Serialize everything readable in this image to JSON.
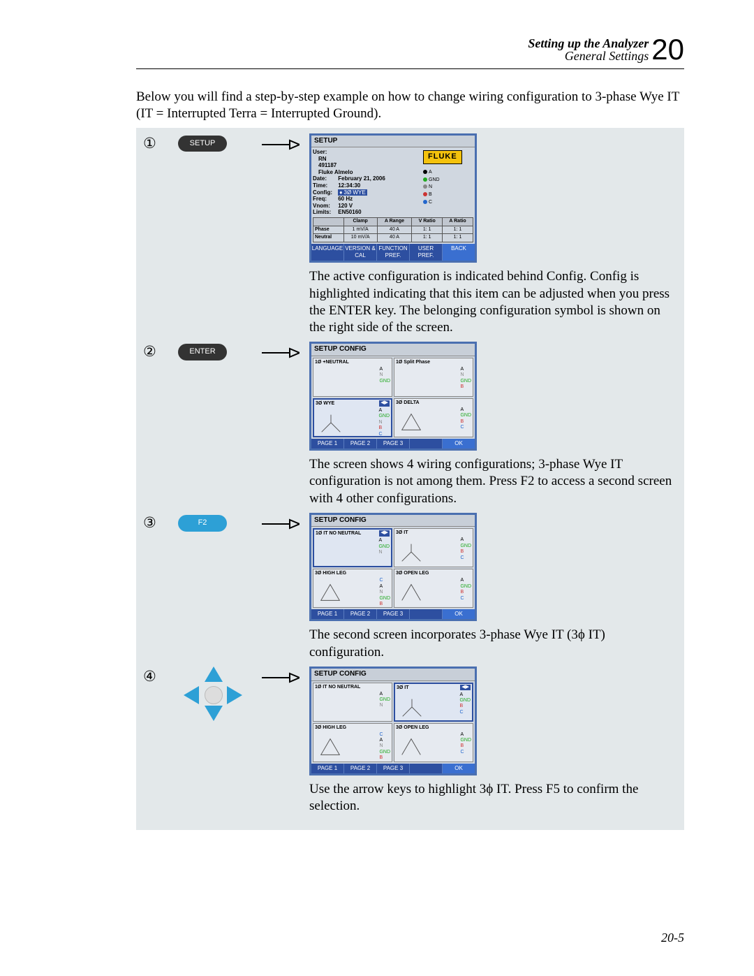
{
  "header": {
    "title": "Setting up the Analyzer",
    "subtitle": "General Settings",
    "chapter_number": "20"
  },
  "intro": "Below you will find a step-by-step example on how to change wiring configuration to 3-phase Wye IT (IT = Interrupted Terra = Interrupted Ground).",
  "page_number": "20-5",
  "step_markers": [
    "①",
    "②",
    "③",
    "④"
  ],
  "keys": {
    "setup": "SETUP",
    "enter": "ENTER",
    "f2": "F2"
  },
  "setup_screen": {
    "title": "SETUP",
    "logo": "FLUKE",
    "fields": {
      "user_label": "User:",
      "user_values": [
        "RN",
        "491187",
        "Fluke Almelo"
      ],
      "date_label": "Date:",
      "date_value": "February 21, 2006",
      "time_label": "Time:",
      "time_value": "12:34:30",
      "config_label": "Config:",
      "config_value": "♦ 3Ø WYE",
      "freq_label": "Freq:",
      "freq_value": "60 Hz",
      "vnom_label": "Vnom:",
      "vnom_value": "120 V",
      "limits_label": "Limits:",
      "limits_value": "EN50160"
    },
    "phase_labels": [
      "A",
      "GND",
      "N",
      "B",
      "C"
    ],
    "table": {
      "headers": [
        "",
        "Clamp",
        "A Range",
        "V Ratio",
        "A Ratio"
      ],
      "rows": [
        [
          "Phase",
          "1 mV/A",
          "40 A",
          "1: 1",
          "1: 1"
        ],
        [
          "Neutral",
          "10 mV/A",
          "40 A",
          "1: 1",
          "1: 1"
        ]
      ]
    },
    "softkeys": [
      "LANGUAGE",
      "VERSION & CAL",
      "FUNCTION PREF.",
      "USER PREF.",
      "BACK"
    ]
  },
  "step1_desc": "The active configuration is indicated behind Config. Config is highlighted indicating that this item can be adjusted when you press the ENTER key. The belonging configuration symbol is shown on the right side of the screen.",
  "config_screen_1": {
    "title": "SETUP CONFIG",
    "cells": [
      "1Ø +NEUTRAL",
      "1Ø Split Phase",
      "3Ø WYE",
      "3Ø DELTA"
    ],
    "selected_index": 2,
    "softkeys": [
      "PAGE 1",
      "PAGE 2",
      "PAGE 3",
      "",
      "OK"
    ]
  },
  "step2_desc": "The screen shows 4 wiring configurations; 3-phase Wye IT configuration is not among them. Press F2 to access a second screen with 4 other configurations.",
  "config_screen_2": {
    "title": "SETUP CONFIG",
    "cells": [
      "1Ø IT NO NEUTRAL",
      "3Ø IT",
      "3Ø HIGH LEG",
      "3Ø OPEN LEG"
    ],
    "selected_index": 0,
    "softkeys": [
      "PAGE 1",
      "PAGE 2",
      "PAGE 3",
      "",
      "OK"
    ]
  },
  "step3_desc": "The second screen incorporates 3-phase Wye IT (3ϕ IT) configuration.",
  "config_screen_3": {
    "title": "SETUP CONFIG",
    "cells": [
      "1Ø IT NO NEUTRAL",
      "3Ø IT",
      "3Ø HIGH LEG",
      "3Ø OPEN LEG"
    ],
    "selected_index": 1,
    "softkeys": [
      "PAGE 1",
      "PAGE 2",
      "PAGE 3",
      "",
      "OK"
    ]
  },
  "step4_desc": "Use the arrow keys to highlight 3ϕ IT. Press F5 to confirm the selection."
}
